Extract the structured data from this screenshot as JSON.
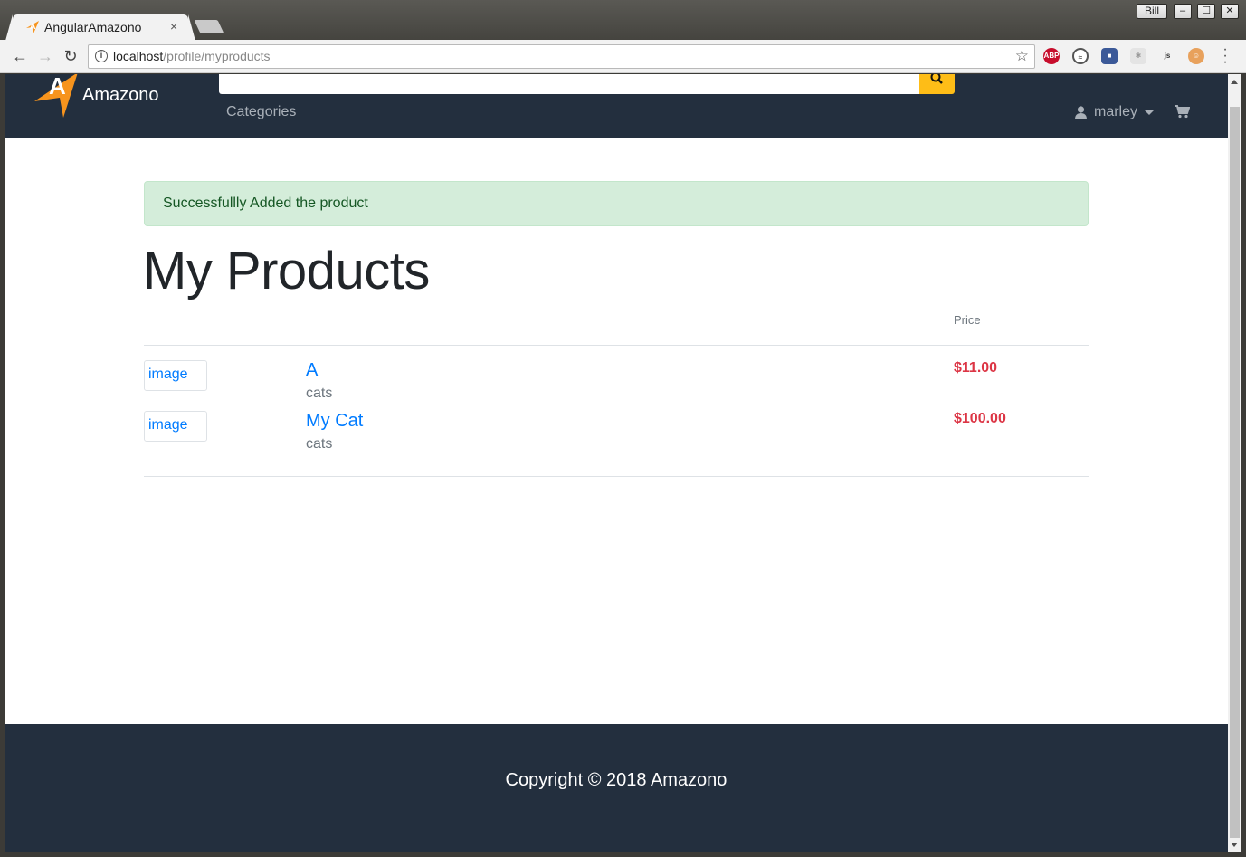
{
  "browser": {
    "profile_name": "Bill",
    "tab_title": "AngularAmazono",
    "tab_close": "×",
    "url_host": "localhost",
    "url_path": "/profile/myproducts",
    "extensions": [
      {
        "name": "adblock-plus-icon",
        "label": "ABP",
        "color": "#c70d2c"
      },
      {
        "name": "sync-icon",
        "label": "",
        "color": "#555555"
      },
      {
        "name": "color-picker-icon",
        "label": "",
        "color": "#3b5998"
      },
      {
        "name": "react-devtools-icon",
        "label": "",
        "color": "#cccccc"
      },
      {
        "name": "js-icon",
        "label": "js",
        "color": "#6d9b3a"
      },
      {
        "name": "tampermonkey-icon",
        "label": "",
        "color": "#b5651d"
      }
    ]
  },
  "navbar": {
    "brand": "Amazono",
    "logo_letter": "A",
    "categories": "Categories",
    "username": "marley"
  },
  "alert": {
    "message": "Successfullly Added the product"
  },
  "page": {
    "title": "My Products",
    "price_header": "Price"
  },
  "products": [
    {
      "image_alt": "image",
      "name": "A",
      "category": "cats",
      "price": "$11.00"
    },
    {
      "image_alt": "image",
      "name": "My Cat",
      "category": "cats",
      "price": "$100.00"
    }
  ],
  "footer": {
    "copyright": "Copyright © 2018 Amazono"
  }
}
